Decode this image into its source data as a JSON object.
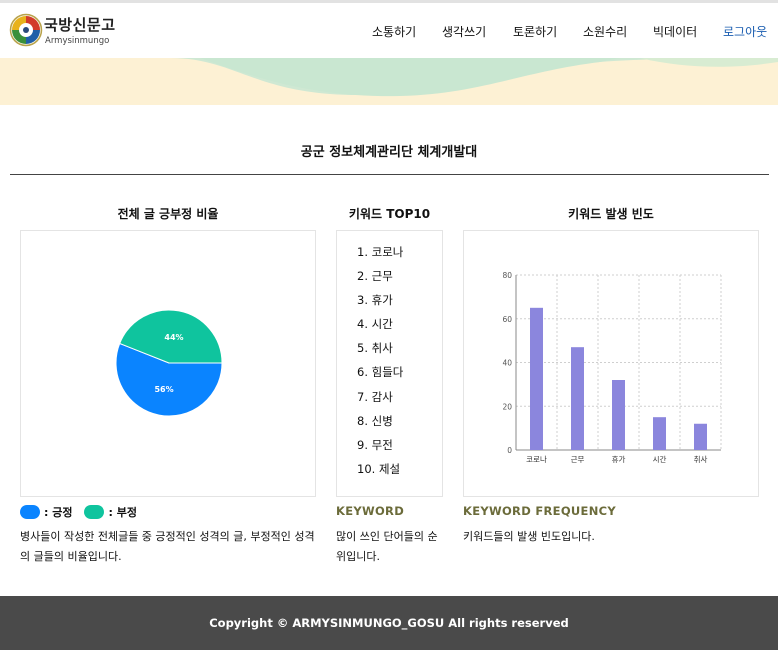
{
  "header": {
    "brand_ko": "국방신문고",
    "brand_en": "Armysinmungo",
    "nav": [
      "소통하기",
      "생각쓰기",
      "토론하기",
      "소원수리",
      "빅데이터"
    ],
    "logout": "로그아웃"
  },
  "page_title": "공군 정보체계관리단 체계개발대",
  "sentiment": {
    "title": "전체 글 긍부정 비율",
    "legend": [
      {
        "label": ": 긍정",
        "color": "#0a84ff"
      },
      {
        "label": ": 부정",
        "color": "#0fc49e"
      }
    ],
    "description": "병사들이 작성한 전체글들 중 긍정적인 성격의 글, 부정적인 성격의 글들의 비율입니다."
  },
  "keywords": {
    "title": "키워드 TOP10",
    "items": [
      "1. 코로나",
      "2. 근무",
      "3. 휴가",
      "4. 시간",
      "5. 취사",
      "6. 힘들다",
      "7. 감사",
      "8. 신병",
      "9. 무전",
      "10. 제설"
    ],
    "subheading": "KEYWORD",
    "description": "많이 쓰인 단어들의 순위입니다."
  },
  "frequency": {
    "title": "키워드 발생 빈도",
    "subheading": "KEYWORD FREQUENCY",
    "description": "키워드들의 발생 빈도입니다."
  },
  "chart_data": [
    {
      "type": "pie",
      "labels": [
        "긍정",
        "부정"
      ],
      "values": [
        56,
        44
      ],
      "value_labels": [
        "56%",
        "44%"
      ],
      "colors": [
        "#0a84ff",
        "#0fc49e"
      ]
    },
    {
      "type": "bar",
      "categories": [
        "코로나",
        "근무",
        "휴가",
        "시간",
        "취사"
      ],
      "values": [
        65,
        47,
        32,
        15,
        12
      ],
      "yticks": [
        0,
        20,
        40,
        60,
        80
      ],
      "ylim": [
        0,
        80
      ],
      "grid": true,
      "color": "#8b86dd"
    }
  ],
  "footer": "Copyright © ARMYSINMUNGO_GOSU All rights reserved"
}
